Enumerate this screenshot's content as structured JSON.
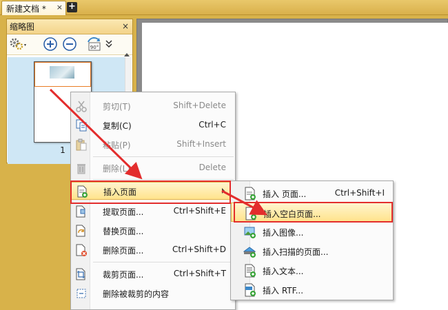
{
  "tabbar": {
    "doc_tab_label": "新建文档 *",
    "close_glyph": "×",
    "new_tab_glyph": "+"
  },
  "thumbnail_panel": {
    "title": "缩略图",
    "close_glyph": "×",
    "rotate_label": "90°",
    "page_number": "1"
  },
  "context_menu": {
    "items": [
      {
        "label": "剪切(T)",
        "shortcut": "Shift+Delete",
        "disabled": true,
        "icon": "scissors-icon"
      },
      {
        "label": "复制(C)",
        "shortcut": "Ctrl+C",
        "disabled": false,
        "icon": "copy-icon"
      },
      {
        "label": "粘贴(P)",
        "shortcut": "Shift+Insert",
        "disabled": true,
        "icon": "paste-icon"
      },
      {
        "label": "删除(L)",
        "shortcut": "Delete",
        "disabled": true,
        "icon": "trash-icon"
      },
      {
        "label": "插入页面",
        "shortcut": "",
        "disabled": false,
        "icon": "insert-page-icon",
        "highlighted": true,
        "has_submenu": true
      },
      {
        "label": "提取页面...",
        "shortcut": "Ctrl+Shift+E",
        "disabled": false,
        "icon": "extract-page-icon"
      },
      {
        "label": "替换页面...",
        "shortcut": "",
        "disabled": false,
        "icon": "replace-page-icon"
      },
      {
        "label": "删除页面...",
        "shortcut": "Ctrl+Shift+D",
        "disabled": false,
        "icon": "delete-page-icon"
      },
      {
        "label": "裁剪页面...",
        "shortcut": "Ctrl+Shift+T",
        "disabled": false,
        "icon": "crop-page-icon"
      },
      {
        "label": "删除被裁剪的内容",
        "shortcut": "",
        "disabled": false,
        "icon": "remove-cropped-icon"
      }
    ]
  },
  "submenu": {
    "items": [
      {
        "label": "插入 页面...",
        "shortcut": "Ctrl+Shift+I",
        "icon": "insert-page-icon"
      },
      {
        "label": "插入空白页面...",
        "shortcut": "",
        "icon": "blank-page-icon",
        "highlighted": true
      },
      {
        "label": "插入图像...",
        "shortcut": "",
        "icon": "image-icon"
      },
      {
        "label": "插入扫描的页面...",
        "shortcut": "",
        "icon": "scanner-icon"
      },
      {
        "label": "插入文本...",
        "shortcut": "",
        "icon": "text-file-icon"
      },
      {
        "label": "插入 RTF...",
        "shortcut": "",
        "icon": "rtf-file-icon"
      }
    ]
  },
  "colors": {
    "accent_red": "#e32d2d",
    "highlight": "#ffe38c",
    "chrome": "#d8b24a"
  }
}
